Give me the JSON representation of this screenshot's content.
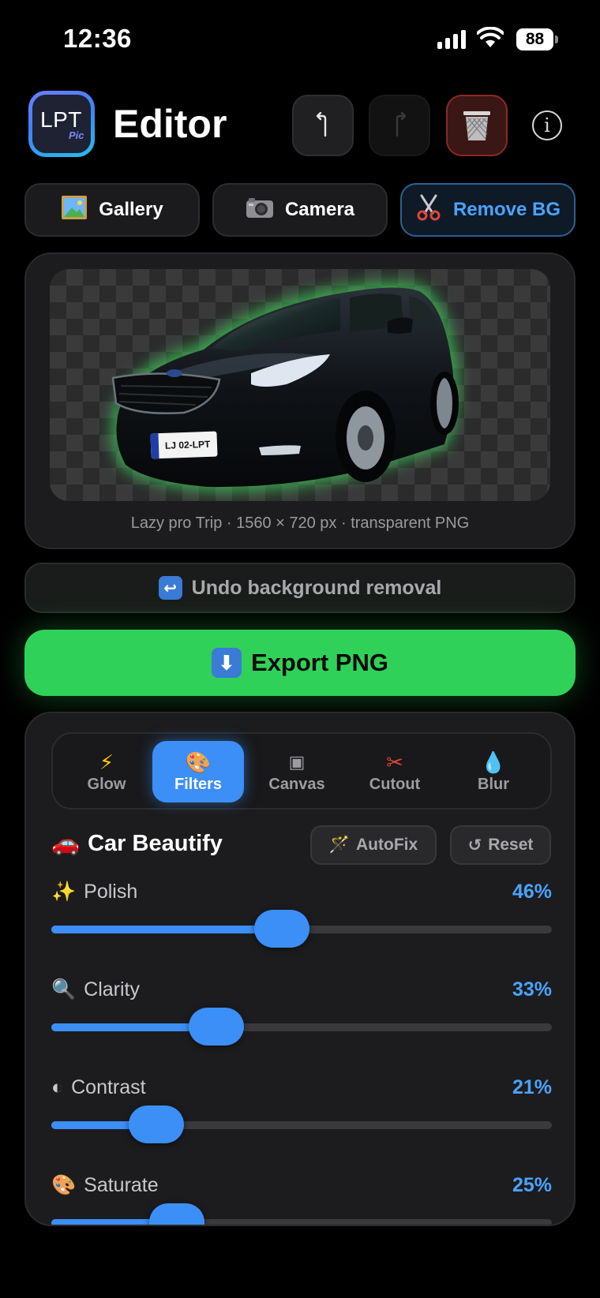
{
  "status_bar": {
    "time": "12:36",
    "battery": "88"
  },
  "header": {
    "logo_text": "LPT",
    "logo_sub": "Pic",
    "title": "Editor",
    "undo_icon": "undo-arrow-icon",
    "redo_icon": "redo-arrow-icon",
    "trash_icon": "trash-icon",
    "info_symbol": "i"
  },
  "source_buttons": [
    {
      "icon": "🖼",
      "label": "Gallery"
    },
    {
      "icon": "📷",
      "label": "Camera"
    },
    {
      "icon": "✂",
      "label": "Remove BG"
    }
  ],
  "preview": {
    "plate_text": "LJ 02-LPT",
    "caption": "Lazy pro Trip · 1560 × 720 px · transparent PNG"
  },
  "undo_removal": {
    "icon": "↩",
    "label": "Undo background removal"
  },
  "export": {
    "icon": "⬇",
    "label": "Export PNG"
  },
  "tabs": [
    {
      "icon": "⚡",
      "label": "Glow",
      "active": false
    },
    {
      "icon": "🎨",
      "label": "Filters",
      "active": true
    },
    {
      "icon": "▣",
      "label": "Canvas",
      "active": false
    },
    {
      "icon": "✂",
      "label": "Cutout",
      "active": false
    },
    {
      "icon": "💧",
      "label": "Blur",
      "active": false
    }
  ],
  "section": {
    "icon": "🚗",
    "title": "Car Beautify",
    "autofix_icon": "🪄",
    "autofix_label": "AutoFix",
    "reset_icon": "↺",
    "reset_label": "Reset"
  },
  "sliders": [
    {
      "icon": "✨",
      "label": "Polish",
      "value_text": "46%",
      "value": 0.46
    },
    {
      "icon": "🔍",
      "label": "Clarity",
      "value_text": "33%",
      "value": 0.33
    },
    {
      "icon": "◐",
      "label": "Contrast",
      "value_text": "21%",
      "value": 0.21
    },
    {
      "icon": "🎨",
      "label": "Saturate",
      "value_text": "25%",
      "value": 0.25
    }
  ],
  "colors": {
    "accent": "#3b8ff7",
    "export_green": "#30d158",
    "remove_bg_text": "#4aa3ff",
    "trash_border": "#8a2a24"
  }
}
